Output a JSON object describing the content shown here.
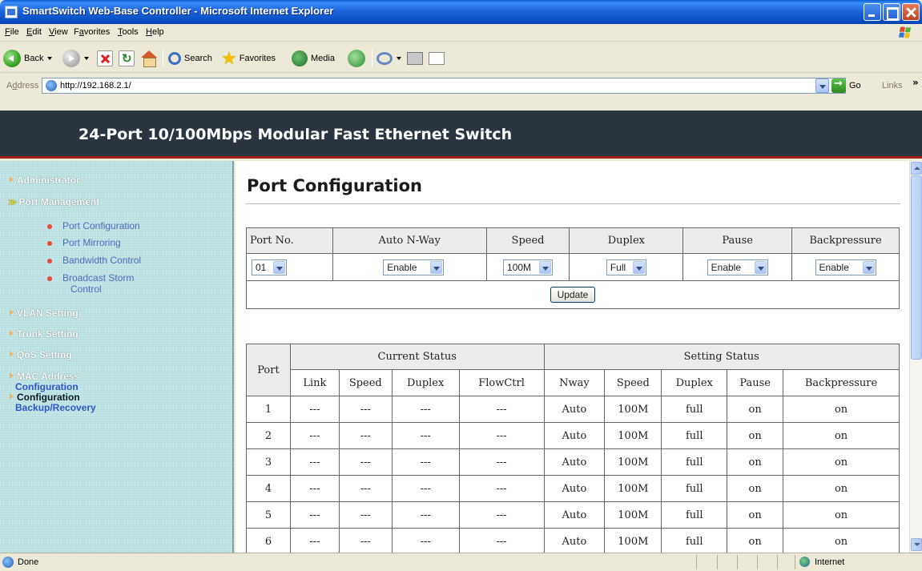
{
  "window": {
    "title": "SmartSwitch Web-Base Controller - Microsoft Internet Explorer"
  },
  "menubar": {
    "items": [
      {
        "label": "File",
        "accel": "F",
        "rest": "ile"
      },
      {
        "label": "Edit",
        "accel": "E",
        "rest": "dit"
      },
      {
        "label": "View",
        "accel": "V",
        "rest": "iew"
      },
      {
        "label": "Favorites",
        "pre": "F",
        "accel": "a",
        "rest": "vorites"
      },
      {
        "label": "Tools",
        "accel": "T",
        "rest": "ools"
      },
      {
        "label": "Help",
        "accel": "H",
        "rest": "elp"
      }
    ]
  },
  "toolbar": {
    "back_label": "Back",
    "search_label": "Search",
    "favorites_label": "Favorites",
    "media_label": "Media",
    "icons": [
      "back-icon",
      "forward-icon",
      "stop-icon",
      "refresh-icon",
      "home-icon",
      "search-icon",
      "favorites-star-icon",
      "media-icon",
      "history-icon",
      "mail-icon",
      "print-icon",
      "edit-icon"
    ]
  },
  "address": {
    "label": "Address",
    "accel": "d",
    "url": "http://192.168.2.1/",
    "go_label": "Go",
    "links_label": "Links"
  },
  "banner": {
    "title": "24-Port 10/100Mbps Modular Fast Ethernet Switch"
  },
  "nav": {
    "administrator": "Administrator",
    "port_management": "Port Management",
    "sub_items": [
      "Port Configuration",
      "Port Mirroring",
      "Bandwidth Control",
      "Broadcast Storm",
      "Control"
    ],
    "vlan": "VLAN Setting",
    "trunk": "Trunk Setting",
    "qos": "QoS Setting",
    "mac_1": "MAC Address",
    "mac_2": "Configuration",
    "cfg_1": "Configuration",
    "cfg_2": "Backup/Recovery"
  },
  "main": {
    "title": "Port Configuration",
    "config": {
      "headers": [
        "Port No.",
        "Auto N-Way",
        "Speed",
        "Duplex",
        "Pause",
        "Backpressure"
      ],
      "values": {
        "port": "01",
        "auto_nway": "Enable",
        "speed": "100M",
        "duplex": "Full",
        "pause": "Enable",
        "backpressure": "Enable"
      },
      "update_label": "Update"
    },
    "status": {
      "port_header": "Port",
      "current_header": "Current Status",
      "setting_header": "Setting Status",
      "columns": [
        "Link",
        "Speed",
        "Duplex",
        "FlowCtrl",
        "Nway",
        "Speed",
        "Duplex",
        "Pause",
        "Backpressure"
      ],
      "rows": [
        [
          "1",
          "---",
          "---",
          "---",
          "---",
          "Auto",
          "100M",
          "full",
          "on",
          "on"
        ],
        [
          "2",
          "---",
          "---",
          "---",
          "---",
          "Auto",
          "100M",
          "full",
          "on",
          "on"
        ],
        [
          "3",
          "---",
          "---",
          "---",
          "---",
          "Auto",
          "100M",
          "full",
          "on",
          "on"
        ],
        [
          "4",
          "---",
          "---",
          "---",
          "---",
          "Auto",
          "100M",
          "full",
          "on",
          "on"
        ],
        [
          "5",
          "---",
          "---",
          "---",
          "---",
          "Auto",
          "100M",
          "full",
          "on",
          "on"
        ],
        [
          "6",
          "---",
          "---",
          "---",
          "---",
          "Auto",
          "100M",
          "full",
          "on",
          "on"
        ]
      ]
    }
  },
  "statusbar": {
    "status_text": "Done",
    "zone_text": "Internet"
  },
  "colors": {
    "banner_bg": "#2a3540",
    "nav_bg": "#b5dede",
    "nav_link": "#4b6cc1",
    "title_bar": "#0a5fd8"
  }
}
